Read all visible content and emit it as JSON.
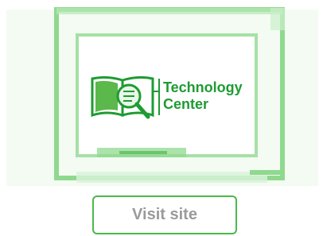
{
  "logo": {
    "line1": "Technology",
    "line2": "Center",
    "icon": "book-magnifier-icon",
    "color": "#1e9b32"
  },
  "frame": {
    "color": "#7fd07f"
  },
  "visit_button": {
    "label": "Visit site",
    "border_color": "#4cb84c",
    "text_color": "#9a9a9a"
  }
}
